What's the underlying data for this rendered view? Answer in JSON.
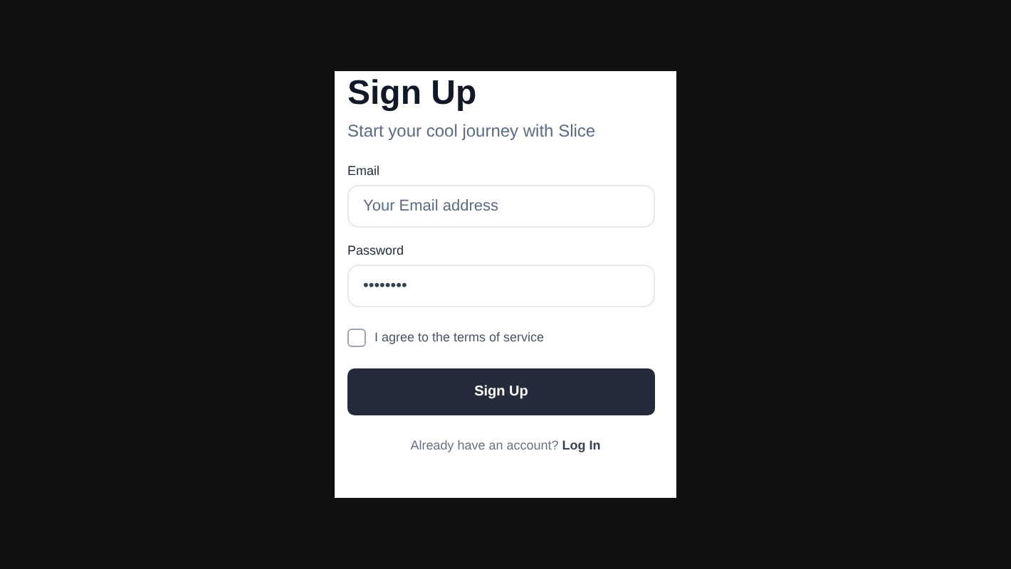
{
  "title": "Sign Up",
  "subtitle": "Start your cool journey with Slice",
  "fields": [
    {
      "label": "Email",
      "placeholder": "Your Email address"
    },
    {
      "label": "Password",
      "value": "••••••••"
    }
  ],
  "terms": {
    "label": "I agree to the terms of service",
    "checked": false
  },
  "submit": "Sign Up",
  "footer": {
    "text": "Already have an account?",
    "link": "Log In"
  }
}
